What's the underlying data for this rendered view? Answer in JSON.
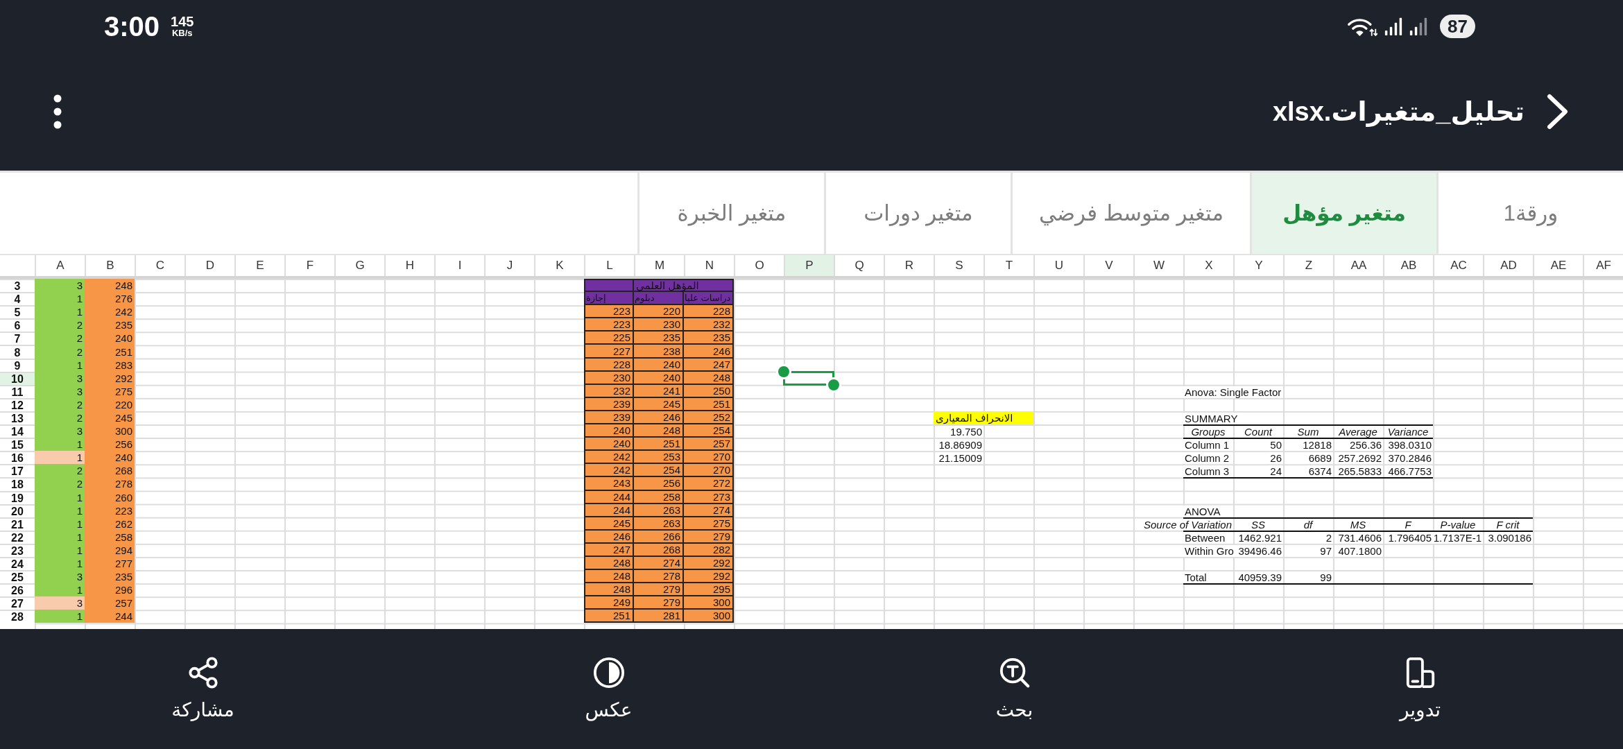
{
  "status_bar": {
    "time": "3:00",
    "network_speed": "145",
    "network_speed_unit": "KB/s",
    "battery": "87"
  },
  "app_bar": {
    "title": "تحليل_متغيرات.xlsx"
  },
  "sheet_tabs": [
    {
      "label": "ورقة1",
      "selected": false
    },
    {
      "label": "متغير مؤهل",
      "selected": true
    },
    {
      "label": "متغير متوسط فرضي",
      "selected": false
    },
    {
      "label": "متغير دورات",
      "selected": false
    },
    {
      "label": "متغير الخبرة",
      "selected": false
    }
  ],
  "sheet": {
    "columns": [
      {
        "label": "A",
        "selected": false
      },
      {
        "label": "B",
        "selected": false
      },
      {
        "label": "C",
        "selected": false
      },
      {
        "label": "D",
        "selected": false
      },
      {
        "label": "E",
        "selected": false
      },
      {
        "label": "F",
        "selected": false
      },
      {
        "label": "G",
        "selected": false
      },
      {
        "label": "H",
        "selected": false
      },
      {
        "label": "I",
        "selected": false
      },
      {
        "label": "J",
        "selected": false
      },
      {
        "label": "K",
        "selected": false
      },
      {
        "label": "L",
        "selected": false
      },
      {
        "label": "M",
        "selected": false
      },
      {
        "label": "N",
        "selected": false
      },
      {
        "label": "O",
        "selected": false
      },
      {
        "label": "P",
        "selected": true
      },
      {
        "label": "Q",
        "selected": false
      },
      {
        "label": "R",
        "selected": false
      },
      {
        "label": "S",
        "selected": false
      },
      {
        "label": "T",
        "selected": false
      },
      {
        "label": "U",
        "selected": false
      },
      {
        "label": "V",
        "selected": false
      },
      {
        "label": "W",
        "selected": false
      },
      {
        "label": "X",
        "selected": false
      },
      {
        "label": "Y",
        "selected": false
      },
      {
        "label": "Z",
        "selected": false
      },
      {
        "label": "AA",
        "selected": false
      },
      {
        "label": "AB",
        "selected": false
      },
      {
        "label": "AC",
        "selected": false
      },
      {
        "label": "AD",
        "selected": false
      },
      {
        "label": "AE",
        "selected": false
      },
      {
        "label": "AF",
        "selected": false
      }
    ],
    "rows": [
      {
        "label": "3",
        "selected": false
      },
      {
        "label": "4",
        "selected": false
      },
      {
        "label": "5",
        "selected": false
      },
      {
        "label": "6",
        "selected": false
      },
      {
        "label": "7",
        "selected": false
      },
      {
        "label": "8",
        "selected": false
      },
      {
        "label": "9",
        "selected": false
      },
      {
        "label": "10",
        "selected": true
      },
      {
        "label": "11",
        "selected": false
      },
      {
        "label": "12",
        "selected": false
      },
      {
        "label": "13",
        "selected": false
      },
      {
        "label": "14",
        "selected": false
      },
      {
        "label": "15",
        "selected": false
      },
      {
        "label": "16",
        "selected": false
      },
      {
        "label": "17",
        "selected": false
      },
      {
        "label": "18",
        "selected": false
      },
      {
        "label": "19",
        "selected": false
      },
      {
        "label": "20",
        "selected": false
      },
      {
        "label": "21",
        "selected": false
      },
      {
        "label": "22",
        "selected": false
      },
      {
        "label": "23",
        "selected": false
      },
      {
        "label": "24",
        "selected": false
      },
      {
        "label": "25",
        "selected": false
      },
      {
        "label": "26",
        "selected": false
      },
      {
        "label": "27",
        "selected": false
      },
      {
        "label": "28",
        "selected": false
      }
    ],
    "group_scores": [
      {
        "group": "3",
        "color": "#92d050",
        "score": "248"
      },
      {
        "group": "1",
        "color": "#92d050",
        "score": "276"
      },
      {
        "group": "1",
        "color": "#92d050",
        "score": "242"
      },
      {
        "group": "2",
        "color": "#92d050",
        "score": "235"
      },
      {
        "group": "2",
        "color": "#92d050",
        "score": "240"
      },
      {
        "group": "2",
        "color": "#92d050",
        "score": "251"
      },
      {
        "group": "1",
        "color": "#92d050",
        "score": "283"
      },
      {
        "group": "3",
        "color": "#92d050",
        "score": "292"
      },
      {
        "group": "3",
        "color": "#92d050",
        "score": "275"
      },
      {
        "group": "2",
        "color": "#92d050",
        "score": "220"
      },
      {
        "group": "2",
        "color": "#92d050",
        "score": "245"
      },
      {
        "group": "3",
        "color": "#92d050",
        "score": "300"
      },
      {
        "group": "1",
        "color": "#92d050",
        "score": "256"
      },
      {
        "group": "1",
        "color": "#f8cbad",
        "score": "240"
      },
      {
        "group": "2",
        "color": "#92d050",
        "score": "268"
      },
      {
        "group": "2",
        "color": "#92d050",
        "score": "278"
      },
      {
        "group": "1",
        "color": "#92d050",
        "score": "260"
      },
      {
        "group": "1",
        "color": "#92d050",
        "score": "223"
      },
      {
        "group": "1",
        "color": "#92d050",
        "score": "262"
      },
      {
        "group": "1",
        "color": "#92d050",
        "score": "258"
      },
      {
        "group": "1",
        "color": "#92d050",
        "score": "294"
      },
      {
        "group": "1",
        "color": "#92d050",
        "score": "277"
      },
      {
        "group": "3",
        "color": "#92d050",
        "score": "235"
      },
      {
        "group": "1",
        "color": "#92d050",
        "score": "296"
      },
      {
        "group": "3",
        "color": "#f8cbad",
        "score": "257"
      },
      {
        "group": "1",
        "color": "#92d050",
        "score": "244"
      }
    ],
    "qualification_table": {
      "title": "المؤهل العلمي",
      "columns": [
        {
          "header": "دراسات عليا",
          "values": [
            "228",
            "232",
            "235",
            "246",
            "247",
            "248",
            "250",
            "251",
            "252",
            "254",
            "257",
            "270",
            "270",
            "272",
            "273",
            "274",
            "275",
            "279",
            "282",
            "292",
            "292",
            "295",
            "300",
            "300"
          ]
        },
        {
          "header": "دبلوم",
          "values": [
            "220",
            "230",
            "235",
            "238",
            "240",
            "240",
            "241",
            "245",
            "246",
            "248",
            "251",
            "253",
            "254",
            "256",
            "258",
            "263",
            "263",
            "266",
            "268",
            "274",
            "278",
            "279",
            "279",
            "281"
          ]
        },
        {
          "header": "إجازة",
          "values": [
            "223",
            "223",
            "225",
            "227",
            "228",
            "230",
            "232",
            "239",
            "239",
            "240",
            "240",
            "242",
            "242",
            "243",
            "244",
            "244",
            "245",
            "246",
            "247",
            "248",
            "248",
            "248",
            "249",
            "251"
          ]
        }
      ]
    },
    "std_dev": {
      "label": "الانحراف المعيارى",
      "values": [
        "19.750",
        "18.86909",
        "21.15009"
      ]
    },
    "anova": {
      "title": "Anova: Single Factor",
      "summary_label": "SUMMARY",
      "summary_columns": [
        "Groups",
        "Count",
        "Sum",
        "Average",
        "Variance"
      ],
      "summary_rows": [
        [
          "Column 1",
          "50",
          "12818",
          "256.36",
          "398.0310"
        ],
        [
          "Column 2",
          "26",
          "6689",
          "257.2692",
          "370.2846"
        ],
        [
          "Column 3",
          "24",
          "6374",
          "265.5833",
          "466.7753"
        ]
      ],
      "table_label": "ANOVA",
      "table_columns": [
        "Source of Variation",
        "SS",
        "df",
        "MS",
        "F",
        "P-value",
        "F crit"
      ],
      "table_rows": [
        [
          "Between",
          "1462.921",
          "2",
          "731.4606",
          "1.796405",
          "1.7137E-1",
          "3.090186"
        ],
        [
          "Within Gro",
          "39496.46",
          "97",
          "407.1800"
        ]
      ],
      "total_row": [
        "Total",
        "40959.39",
        "99"
      ]
    }
  },
  "bottom_bar": {
    "buttons": [
      {
        "label": "تدوير"
      },
      {
        "label": "بحث"
      },
      {
        "label": "عكس"
      },
      {
        "label": "مشاركة"
      }
    ]
  }
}
